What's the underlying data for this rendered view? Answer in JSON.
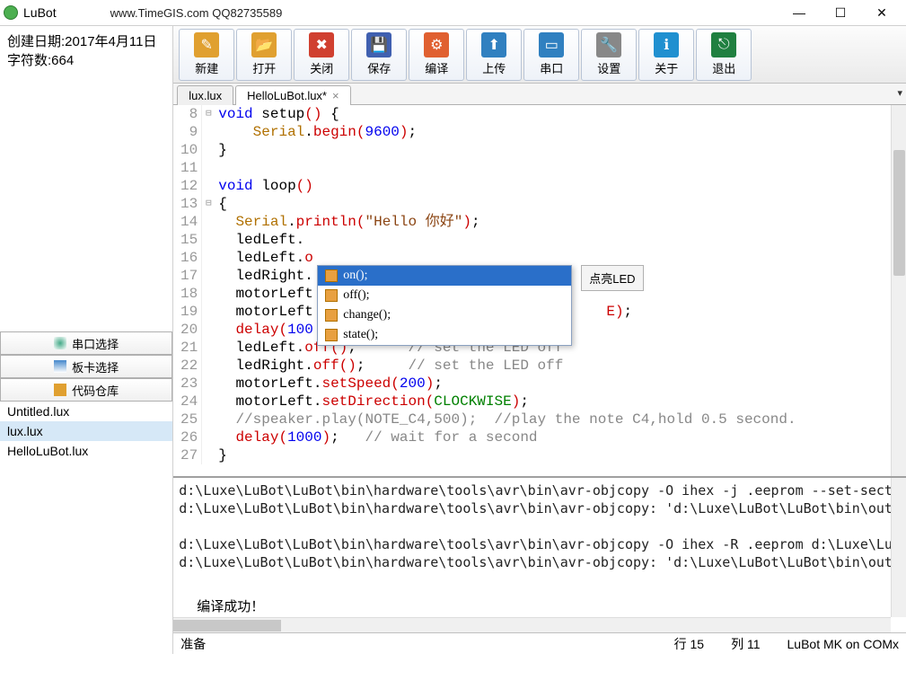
{
  "title": "LuBot",
  "url": "www.TimeGIS.com QQ82735589",
  "info": {
    "createdLabel": "创建日期:2017年4月11日",
    "charsLabel": "字符数:664"
  },
  "sideButtons": {
    "serial": "串口选择",
    "board": "板卡选择",
    "repo": "代码仓库"
  },
  "files": [
    "Untitled.lux",
    "lux.lux",
    "HelloLuBot.lux"
  ],
  "selectedFile": "lux.lux",
  "toolbar": [
    {
      "id": "new",
      "label": "新建",
      "bg": "#e0a030",
      "glyph": "✎"
    },
    {
      "id": "open",
      "label": "打开",
      "bg": "#e0a030",
      "glyph": "📂"
    },
    {
      "id": "close",
      "label": "关闭",
      "bg": "#d04030",
      "glyph": "✖"
    },
    {
      "id": "save",
      "label": "保存",
      "bg": "#4060b0",
      "glyph": "💾"
    },
    {
      "id": "compile",
      "label": "编译",
      "bg": "#e06030",
      "glyph": "⚙"
    },
    {
      "id": "upload",
      "label": "上传",
      "bg": "#3080c0",
      "glyph": "⬆"
    },
    {
      "id": "serialport",
      "label": "串口",
      "bg": "#3080c0",
      "glyph": "▭"
    },
    {
      "id": "settings",
      "label": "设置",
      "bg": "#888",
      "glyph": "🔧"
    },
    {
      "id": "about",
      "label": "关于",
      "bg": "#2090d0",
      "glyph": "ℹ"
    },
    {
      "id": "exit",
      "label": "退出",
      "bg": "#208040",
      "glyph": "⎋"
    }
  ],
  "tabs": [
    {
      "label": "lux.lux",
      "active": false
    },
    {
      "label": "HelloLuBot.lux*",
      "active": true
    }
  ],
  "code": {
    "start": 8,
    "lines": [
      [
        [
          "fold",
          "⊟"
        ],
        [
          "blue",
          "void"
        ],
        [
          "black",
          " setup"
        ],
        [
          "paren",
          "()"
        ],
        [
          "black",
          " {"
        ]
      ],
      [
        [
          "sp",
          "    "
        ],
        [
          "orange",
          "Serial"
        ],
        [
          "black",
          "."
        ],
        [
          "red",
          "begin"
        ],
        [
          "paren",
          "("
        ],
        [
          "blue",
          "9600"
        ],
        [
          "paren",
          ")"
        ],
        [
          "black",
          ";"
        ]
      ],
      [
        [
          "black",
          "}"
        ]
      ],
      [],
      [
        [
          "blue",
          "void"
        ],
        [
          "black",
          " loop"
        ],
        [
          "paren",
          "()"
        ]
      ],
      [
        [
          "fold",
          "⊟"
        ],
        [
          "black",
          "{"
        ]
      ],
      [
        [
          "sp",
          "  "
        ],
        [
          "orange",
          "Serial"
        ],
        [
          "black",
          "."
        ],
        [
          "red",
          "println"
        ],
        [
          "paren",
          "("
        ],
        [
          "brown",
          "\"Hello 你好\""
        ],
        [
          "paren",
          ")"
        ],
        [
          "black",
          ";"
        ]
      ],
      [
        [
          "sp",
          "  "
        ],
        [
          "black",
          "ledLeft."
        ]
      ],
      [
        [
          "sp",
          "  "
        ],
        [
          "black",
          "ledLeft."
        ],
        [
          "red",
          "o"
        ]
      ],
      [
        [
          "sp",
          "  "
        ],
        [
          "black",
          "ledRight."
        ]
      ],
      [
        [
          "sp",
          "  "
        ],
        [
          "black",
          "motorLeft"
        ]
      ],
      [
        [
          "sp",
          "  "
        ],
        [
          "black",
          "motorLeft"
        ],
        [
          "hidden",
          "                                  "
        ],
        [
          "red",
          "E"
        ],
        [
          "paren",
          ")"
        ],
        [
          "black",
          ";"
        ]
      ],
      [
        [
          "sp",
          "  "
        ],
        [
          "red",
          "delay"
        ],
        [
          "paren",
          "("
        ],
        [
          "blue",
          "100"
        ]
      ],
      [
        [
          "sp",
          "  "
        ],
        [
          "black",
          "ledLeft."
        ],
        [
          "red",
          "off"
        ],
        [
          "paren",
          "()"
        ],
        [
          "black",
          ";      "
        ],
        [
          "gray",
          "// set the LED off"
        ]
      ],
      [
        [
          "sp",
          "  "
        ],
        [
          "black",
          "ledRight."
        ],
        [
          "red",
          "off"
        ],
        [
          "paren",
          "()"
        ],
        [
          "black",
          ";     "
        ],
        [
          "gray",
          "// set the LED off"
        ]
      ],
      [
        [
          "sp",
          "  "
        ],
        [
          "black",
          "motorLeft."
        ],
        [
          "red",
          "setSpeed"
        ],
        [
          "paren",
          "("
        ],
        [
          "blue",
          "200"
        ],
        [
          "paren",
          ")"
        ],
        [
          "black",
          ";"
        ]
      ],
      [
        [
          "sp",
          "  "
        ],
        [
          "black",
          "motorLeft."
        ],
        [
          "red",
          "setDirection"
        ],
        [
          "paren",
          "("
        ],
        [
          "green",
          "CLOCKWISE"
        ],
        [
          "paren",
          ")"
        ],
        [
          "black",
          ";"
        ]
      ],
      [
        [
          "sp",
          "  "
        ],
        [
          "gray",
          "//speaker.play(NOTE_C4,500);  //play the note C4,hold 0.5 second."
        ]
      ],
      [
        [
          "sp",
          "  "
        ],
        [
          "red",
          "delay"
        ],
        [
          "paren",
          "("
        ],
        [
          "blue",
          "1000"
        ],
        [
          "paren",
          ")"
        ],
        [
          "black",
          ";   "
        ],
        [
          "gray",
          "// wait for a second"
        ]
      ],
      [
        [
          "black",
          "}"
        ]
      ]
    ]
  },
  "autocomplete": [
    "on();",
    "off();",
    "change();",
    "state();"
  ],
  "ledBtn": "点亮LED",
  "output": [
    "d:\\Luxe\\LuBot\\LuBot\\bin\\hardware\\tools\\avr\\bin\\avr-objcopy -O ihex -j .eeprom --set-sect",
    "d:\\Luxe\\LuBot\\LuBot\\bin\\hardware\\tools\\avr\\bin\\avr-objcopy: 'd:\\Luxe\\LuBot\\LuBot\\bin\\out",
    "",
    "d:\\Luxe\\LuBot\\LuBot\\bin\\hardware\\tools\\avr\\bin\\avr-objcopy -O ihex -R .eeprom d:\\Luxe\\LuB",
    "d:\\Luxe\\LuBot\\LuBot\\bin\\hardware\\tools\\avr\\bin\\avr-objcopy: 'd:\\Luxe\\LuBot\\LuBot\\bin\\out"
  ],
  "outputSuccess": "编译成功！",
  "status": {
    "ready": "准备",
    "line": "行 15",
    "col": "列 11",
    "port": "LuBot MK on COMx"
  }
}
